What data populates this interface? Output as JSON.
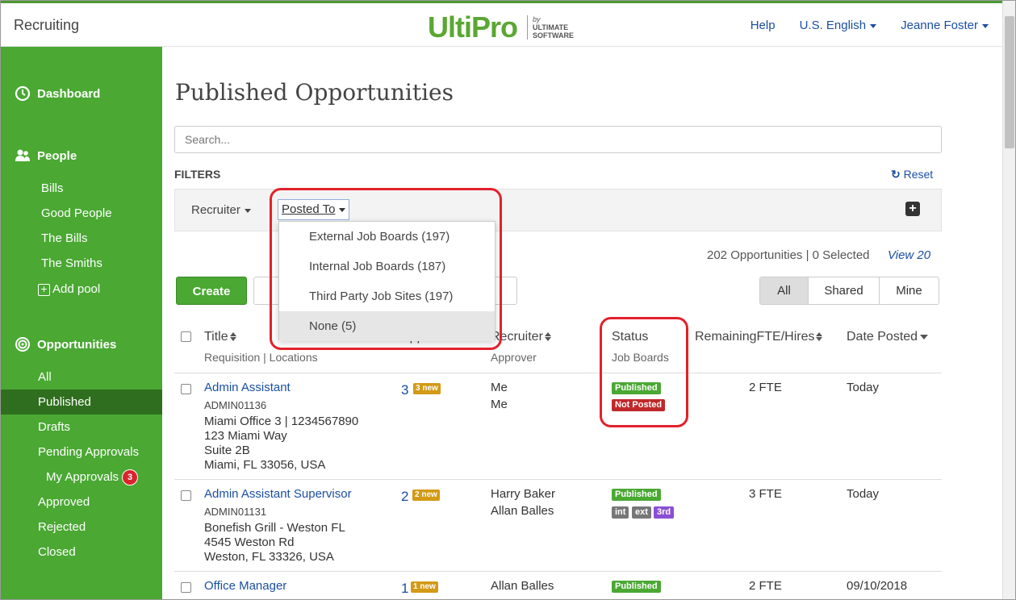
{
  "header": {
    "app_name": "Recruiting",
    "logo_main": "UltiPro",
    "logo_by": "by",
    "logo_company_1": "ULTIMATE",
    "logo_company_2": "SOFTWARE",
    "help": "Help",
    "language": "U.S. English",
    "user": "Jeanne Foster"
  },
  "sidebar": {
    "dashboard": "Dashboard",
    "people": "People",
    "people_items": [
      "Bills",
      "Good People",
      "The Bills",
      "The Smiths"
    ],
    "add_pool": "Add pool",
    "opportunities": "Opportunities",
    "opp_items": [
      "All",
      "Published",
      "Drafts",
      "Pending Approvals"
    ],
    "my_approvals": "My Approvals",
    "my_approvals_count": "3",
    "opp_items_2": [
      "Approved",
      "Rejected",
      "Closed"
    ]
  },
  "main": {
    "title": "Published Opportunities",
    "search_placeholder": "Search...",
    "filters_label": "FILTERS",
    "reset": "Reset",
    "filter_recruiter": "Recruiter",
    "filter_posted_to": "Posted To",
    "dropdown": [
      "External Job Boards (197)",
      "Internal Job Boards (187)",
      "Third Party Job Sites (197)",
      "None (5)"
    ],
    "summary": "202 Opportunities | 0 Selected",
    "view": "View 20",
    "create": "Create",
    "segments": [
      "All",
      "Shared",
      "Mine"
    ]
  },
  "table": {
    "col_title": "Title",
    "col_title_sub": "Requisition | Locations",
    "col_applicants": "Applicants",
    "col_recruiter": "Recruiter",
    "col_recruiter_sub": "Approver",
    "col_status": "Status",
    "col_status_sub": "Job Boards",
    "col_remaining": "RemainingFTE/Hires",
    "col_date": "Date Posted",
    "rows": [
      {
        "title": "Admin Assistant",
        "req": "ADMIN01136",
        "loc1": "Miami Office 3 | 1234567890",
        "loc2": "123 Miami Way",
        "loc3": "Suite 2B",
        "loc4": "Miami, FL 33056, USA",
        "applicants": "3",
        "new": "3 new",
        "recruiter": "Me",
        "approver": "Me",
        "status": "Published",
        "boards": "Not Posted",
        "fte": "2 FTE",
        "date": "Today"
      },
      {
        "title": "Admin Assistant Supervisor",
        "req": "ADMIN01131",
        "loc1": "Bonefish Grill - Weston FL",
        "loc2": "4545 Weston Rd",
        "loc3": "Weston, FL 33326, USA",
        "applicants": "2",
        "new": "2 new",
        "recruiter": "Harry Baker",
        "approver": "Allan Balles",
        "status": "Published",
        "board_tags": [
          "int",
          "ext",
          "3rd"
        ],
        "fte": "3 FTE",
        "date": "Today"
      },
      {
        "title": "Office Manager",
        "applicants": "1",
        "new": "1 new",
        "recruiter": "Allan Balles",
        "status": "Published",
        "fte": "2 FTE",
        "date": "09/10/2018"
      }
    ]
  }
}
